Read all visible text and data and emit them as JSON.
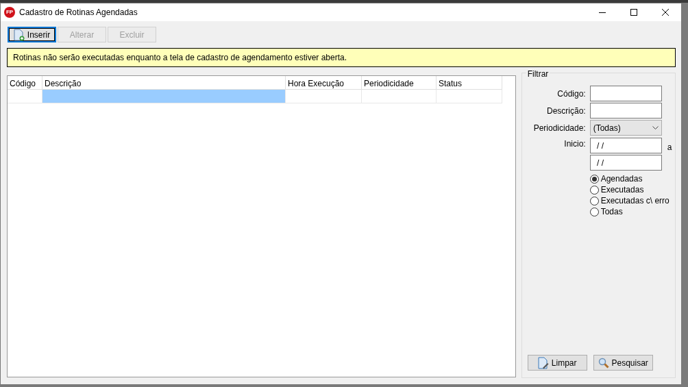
{
  "window": {
    "title": "Cadastro de Rotinas Agendadas",
    "logo": "FP"
  },
  "toolbar": [
    {
      "label": "Inserir",
      "kind": "insert",
      "disabled": false,
      "focused": true
    },
    {
      "label": "Alterar",
      "kind": "edit",
      "disabled": true,
      "focused": false
    },
    {
      "label": "Excluir",
      "kind": "delete",
      "disabled": true,
      "focused": false
    }
  ],
  "notice": "Rotinas não serão executadas enquanto a tela de cadastro de agendamento estiver aberta.",
  "grid": {
    "columns": [
      {
        "label": "Código",
        "selected": false
      },
      {
        "label": "Descrição",
        "selected": true
      },
      {
        "label": "Hora Execução",
        "selected": false
      },
      {
        "label": "Periodicidade",
        "selected": false
      },
      {
        "label": "Status",
        "selected": false
      }
    ]
  },
  "filter": {
    "title": "Filtrar",
    "fields": [
      {
        "kind": "text",
        "label": "Código:"
      },
      {
        "kind": "text",
        "label": "Descrição:"
      },
      {
        "kind": "select",
        "label": "Periodicidade:",
        "value": "(Todas)"
      },
      {
        "kind": "date_range",
        "label": "Inicio:",
        "from": " / /",
        "separator": "a",
        "to": " / /"
      }
    ],
    "status_options": [
      {
        "label": "Agendadas",
        "selected": true
      },
      {
        "label": "Executadas",
        "selected": false
      },
      {
        "label": "Executadas c\\ erro",
        "selected": false
      },
      {
        "label": "Todas",
        "selected": false
      }
    ],
    "buttons": [
      {
        "label": "Limpar",
        "kind": "clear"
      },
      {
        "label": "Pesquisar",
        "kind": "search"
      }
    ]
  }
}
